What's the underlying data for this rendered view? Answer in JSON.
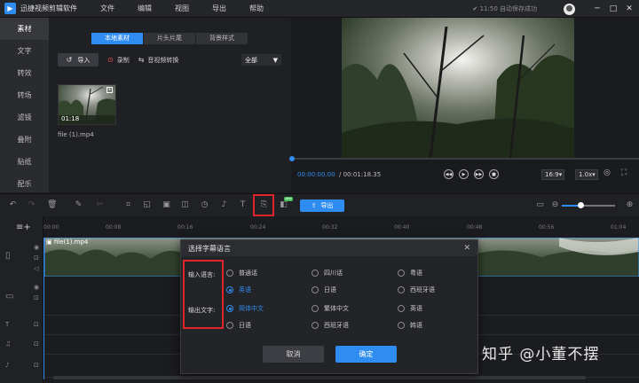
{
  "app": {
    "name": "迅捷视频剪辑软件",
    "logo_glyph": "▶",
    "save_status": "11:50 自动保存成功"
  },
  "menu": [
    "文件",
    "编辑",
    "视图",
    "导出",
    "帮助"
  ],
  "window_controls": {
    "minimize": "─",
    "maximize": "□",
    "close": "✕"
  },
  "sidebar": {
    "items": [
      {
        "label": "素材",
        "active": true
      },
      {
        "label": "文字"
      },
      {
        "label": "转效"
      },
      {
        "label": "转场"
      },
      {
        "label": "滤镜"
      },
      {
        "label": "叠附"
      },
      {
        "label": "贴纸"
      },
      {
        "label": "配乐"
      }
    ]
  },
  "library": {
    "tabs": [
      {
        "label": "本地素材",
        "active": true
      },
      {
        "label": "片头片尾"
      },
      {
        "label": "背景样式"
      }
    ],
    "import_label": "导入",
    "record_label": "录制",
    "convert_label": "音视频转换",
    "filter_value": "全部",
    "media": [
      {
        "name": "file (1).mp4",
        "duration": "01:18"
      }
    ]
  },
  "preview": {
    "current_time": "00:00:00.00",
    "total_time": "/ 00:01:18.35",
    "aspect": "16:9",
    "speed": "1.0x",
    "progress": 0
  },
  "toolbar": {
    "export_label": "导出",
    "new_badge": "NEW"
  },
  "timeline": {
    "ticks": [
      "00:00",
      "00:08",
      "00:16",
      "00:24",
      "00:32",
      "00:40",
      "00:48",
      "00:56",
      "01:04"
    ],
    "clip_name": "file(1).mp4",
    "zoom_level": 0.35
  },
  "dialog": {
    "title": "选择字幕语言",
    "input_label": "输入语言:",
    "output_label": "输出文字:",
    "input_options": [
      {
        "label": "普通话",
        "selected": false
      },
      {
        "label": "四川话",
        "selected": false
      },
      {
        "label": "粤语",
        "selected": false
      },
      {
        "label": "英语",
        "selected": true
      },
      {
        "label": "日语",
        "selected": false
      },
      {
        "label": "西班牙语",
        "selected": false
      }
    ],
    "output_options": [
      {
        "label": "简体中文",
        "selected": true
      },
      {
        "label": "繁体中文",
        "selected": false
      },
      {
        "label": "英语",
        "selected": false
      },
      {
        "label": "日语",
        "selected": false
      },
      {
        "label": "西班牙语",
        "selected": false
      },
      {
        "label": "韩语",
        "selected": false
      }
    ],
    "cancel_label": "取消",
    "ok_label": "确定"
  },
  "watermark": "知乎 @小董不摆",
  "colors": {
    "accent": "#2f8cf0",
    "highlight": "#e0242c",
    "background": "#1d1e21"
  }
}
